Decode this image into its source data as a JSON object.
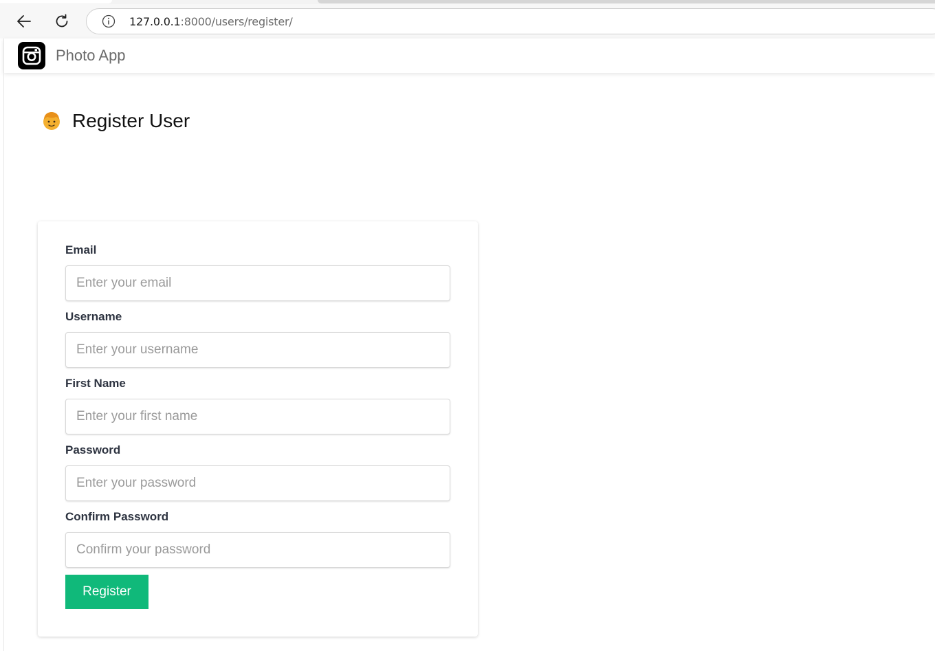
{
  "browser": {
    "url_host": "127.0.0.1",
    "url_path": ":8000/users/register/"
  },
  "navbar": {
    "brand_name": "Photo App"
  },
  "page": {
    "title": "Register User"
  },
  "form": {
    "fields": [
      {
        "label": "Email",
        "placeholder": "Enter your email",
        "value": ""
      },
      {
        "label": "Username",
        "placeholder": "Enter your username",
        "value": ""
      },
      {
        "label": "First Name",
        "placeholder": "Enter your first name",
        "value": ""
      },
      {
        "label": "Password",
        "placeholder": "Enter your password",
        "value": ""
      },
      {
        "label": "Confirm Password",
        "placeholder": "Confirm your password",
        "value": ""
      }
    ],
    "submit_label": "Register"
  },
  "colors": {
    "accent_button": "#10b97a",
    "brand_logo_bg": "#000000"
  },
  "icons": {
    "back": "arrow-left-icon",
    "reload": "reload-icon",
    "site_info": "info-icon",
    "brand": "instagram-camera-icon",
    "heading": "person-emoji-icon"
  }
}
